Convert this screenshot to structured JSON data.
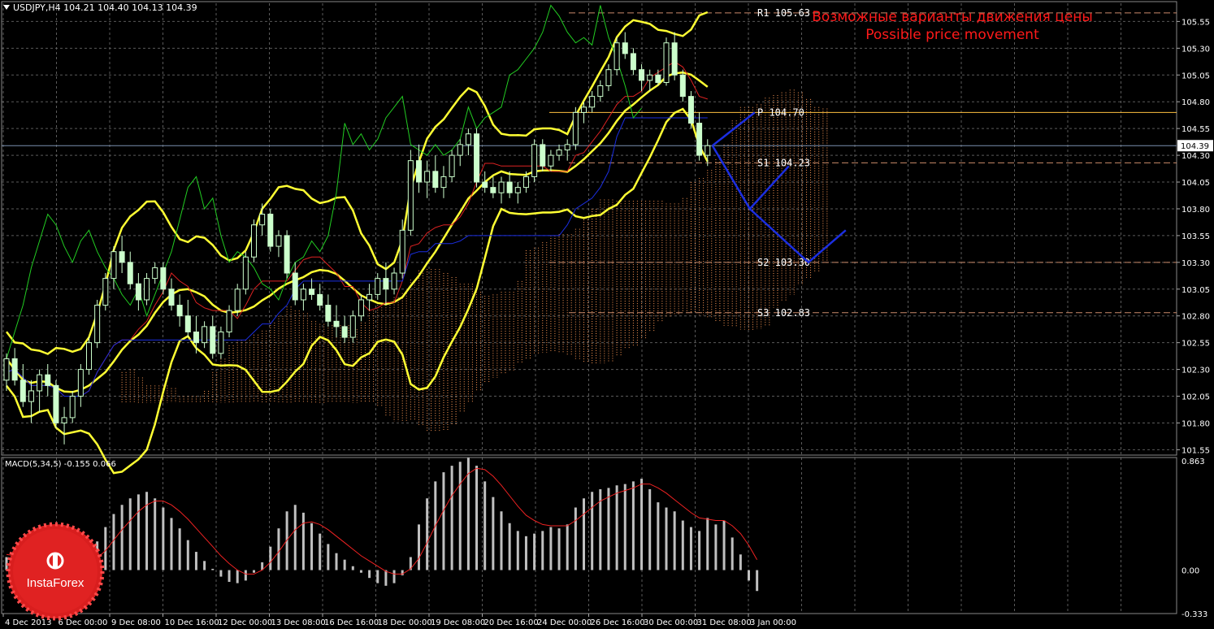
{
  "header": {
    "symbol_line": "USDJPY,H4  104.21 104.40 104.13 104.39"
  },
  "macd_header": "MACD(5,34,5) -0.155 0.066",
  "annotation": {
    "ru": "Возможные варианты движения цены",
    "en": "Possible price movement"
  },
  "logo_text": "InstaForex",
  "colors": {
    "bg": "#000000",
    "grid": "#5a5a5a",
    "yellow": "#ffff33",
    "green": "#22cc22",
    "red": "#dd2222",
    "blue": "#1b2ee0",
    "cloud": "#ff9955",
    "macd_bar": "#c0c0c0",
    "signal": "#ee2222",
    "level": "#c98a6a",
    "pivot": "#ffc040",
    "annotation": "#ff1a1a"
  },
  "chart_data": [
    {
      "type": "line",
      "title": "USDJPY,H4",
      "price_axis": {
        "ticks": [
          "105.55",
          "105.30",
          "105.05",
          "104.80",
          "104.55",
          "104.30",
          "104.05",
          "103.80",
          "103.55",
          "103.30",
          "103.05",
          "102.80",
          "102.55",
          "102.30",
          "102.05",
          "101.80",
          "101.55"
        ],
        "range": [
          101.5,
          105.72
        ]
      },
      "time_axis": {
        "ticks": [
          "4 Dec 2013",
          "6 Dec 00:00",
          "9 Dec 08:00",
          "10 Dec 16:00",
          "12 Dec 00:00",
          "13 Dec 08:00",
          "16 Dec 16:00",
          "18 Dec 00:00",
          "19 Dec 08:00",
          "20 Dec 16:00",
          "24 Dec 00:00",
          "26 Dec 16:00",
          "30 Dec 00:00",
          "31 Dec 08:00",
          "3 Jan 00:00"
        ]
      },
      "current_price": "104.39",
      "levels": [
        {
          "name": "R1",
          "label": "R1 105.63",
          "value": 105.63
        },
        {
          "name": "P",
          "label": "P 104.70",
          "value": 104.7
        },
        {
          "name": "S1",
          "label": "S1 104.23",
          "value": 104.23
        },
        {
          "name": "S2",
          "label": "S2 103.30",
          "value": 103.3
        },
        {
          "name": "S3",
          "label": "S3 102.83",
          "value": 102.83
        }
      ],
      "candles": [
        [
          102.2,
          102.45,
          102.1,
          102.4
        ],
        [
          102.4,
          102.5,
          102.15,
          102.2
        ],
        [
          102.2,
          102.35,
          101.95,
          102.0
        ],
        [
          102.0,
          102.2,
          101.8,
          102.1
        ],
        [
          102.1,
          102.3,
          101.9,
          102.25
        ],
        [
          102.25,
          102.35,
          102.05,
          102.15
        ],
        [
          102.15,
          102.2,
          101.75,
          101.8
        ],
        [
          101.8,
          101.95,
          101.6,
          101.85
        ],
        [
          101.85,
          102.1,
          101.8,
          102.05
        ],
        [
          102.05,
          102.35,
          101.95,
          102.3
        ],
        [
          102.3,
          102.6,
          102.25,
          102.55
        ],
        [
          102.55,
          102.95,
          102.5,
          102.9
        ],
        [
          102.9,
          103.2,
          102.85,
          103.15
        ],
        [
          103.15,
          103.45,
          103.05,
          103.4
        ],
        [
          103.4,
          103.55,
          103.2,
          103.3
        ],
        [
          103.3,
          103.4,
          103.05,
          103.1
        ],
        [
          103.1,
          103.2,
          102.85,
          102.95
        ],
        [
          102.95,
          103.2,
          102.9,
          103.15
        ],
        [
          103.15,
          103.3,
          103.1,
          103.25
        ],
        [
          103.25,
          103.3,
          103.0,
          103.05
        ],
        [
          103.05,
          103.15,
          102.85,
          102.9
        ],
        [
          102.9,
          103.0,
          102.7,
          102.8
        ],
        [
          102.8,
          102.95,
          102.6,
          102.65
        ],
        [
          102.65,
          102.8,
          102.45,
          102.55
        ],
        [
          102.55,
          102.75,
          102.5,
          102.7
        ],
        [
          102.7,
          102.8,
          102.4,
          102.45
        ],
        [
          102.45,
          102.7,
          102.4,
          102.65
        ],
        [
          102.65,
          102.9,
          102.6,
          102.85
        ],
        [
          102.85,
          103.1,
          102.8,
          103.05
        ],
        [
          103.05,
          103.4,
          103.0,
          103.35
        ],
        [
          103.35,
          103.7,
          103.3,
          103.65
        ],
        [
          103.65,
          103.85,
          103.55,
          103.75
        ],
        [
          103.75,
          103.8,
          103.4,
          103.45
        ],
        [
          103.45,
          103.6,
          103.35,
          103.55
        ],
        [
          103.55,
          103.6,
          103.15,
          103.2
        ],
        [
          103.2,
          103.3,
          102.9,
          102.95
        ],
        [
          102.95,
          103.1,
          102.85,
          103.05
        ],
        [
          103.05,
          103.15,
          102.95,
          103.0
        ],
        [
          103.0,
          103.1,
          102.85,
          102.9
        ],
        [
          102.9,
          103.0,
          102.7,
          102.75
        ],
        [
          102.75,
          102.9,
          102.6,
          102.7
        ],
        [
          102.7,
          102.8,
          102.55,
          102.6
        ],
        [
          102.6,
          102.85,
          102.55,
          102.8
        ],
        [
          102.8,
          103.0,
          102.75,
          102.95
        ],
        [
          102.95,
          103.1,
          102.85,
          103.0
        ],
        [
          103.0,
          103.2,
          102.95,
          103.15
        ],
        [
          103.15,
          103.3,
          102.9,
          103.05
        ],
        [
          103.05,
          103.25,
          103.0,
          103.2
        ],
        [
          103.2,
          103.7,
          103.15,
          103.6
        ],
        [
          103.6,
          104.35,
          103.55,
          104.25
        ],
        [
          104.25,
          104.4,
          103.95,
          104.05
        ],
        [
          104.05,
          104.25,
          103.9,
          104.15
        ],
        [
          104.15,
          104.3,
          103.95,
          104.0
        ],
        [
          104.0,
          104.2,
          103.9,
          104.1
        ],
        [
          104.1,
          104.35,
          104.05,
          104.3
        ],
        [
          104.3,
          104.45,
          104.2,
          104.4
        ],
        [
          104.4,
          104.55,
          104.3,
          104.5
        ],
        [
          104.5,
          104.55,
          104.0,
          104.05
        ],
        [
          104.05,
          104.15,
          103.95,
          104.0
        ],
        [
          104.0,
          104.1,
          103.9,
          103.95
        ],
        [
          103.95,
          104.1,
          103.85,
          104.05
        ],
        [
          104.05,
          104.15,
          103.9,
          103.95
        ],
        [
          103.95,
          104.05,
          103.85,
          104.0
        ],
        [
          104.0,
          104.15,
          103.95,
          104.1
        ],
        [
          104.1,
          104.45,
          104.05,
          104.4
        ],
        [
          104.4,
          104.45,
          104.15,
          104.2
        ],
        [
          104.2,
          104.35,
          104.15,
          104.3
        ],
        [
          104.3,
          104.4,
          104.25,
          104.35
        ],
        [
          104.35,
          104.45,
          104.25,
          104.4
        ],
        [
          104.4,
          104.75,
          104.35,
          104.7
        ],
        [
          104.7,
          104.8,
          104.6,
          104.75
        ],
        [
          104.75,
          104.9,
          104.7,
          104.85
        ],
        [
          104.85,
          105.0,
          104.8,
          104.95
        ],
        [
          104.95,
          105.15,
          104.9,
          105.1
        ],
        [
          105.1,
          105.4,
          105.05,
          105.35
        ],
        [
          105.35,
          105.45,
          105.2,
          105.25
        ],
        [
          105.25,
          105.3,
          105.05,
          105.1
        ],
        [
          105.1,
          105.15,
          104.9,
          105.0
        ],
        [
          105.0,
          105.1,
          104.9,
          105.05
        ],
        [
          105.05,
          105.1,
          104.95,
          104.98
        ],
        [
          104.98,
          105.4,
          104.95,
          105.35
        ],
        [
          105.35,
          105.45,
          105.0,
          105.05
        ],
        [
          105.05,
          105.1,
          104.8,
          104.85
        ],
        [
          104.85,
          104.9,
          104.55,
          104.6
        ],
        [
          104.6,
          104.7,
          104.25,
          104.3
        ],
        [
          104.3,
          104.45,
          104.2,
          104.39
        ]
      ],
      "projection": {
        "path_a": [
          104.39,
          104.7
        ],
        "path_b": [
          104.39,
          103.8,
          104.2
        ],
        "path_c": [
          103.8,
          103.3,
          103.6
        ]
      }
    },
    {
      "type": "bar",
      "title": "MACD(5,34,5)",
      "axis_ticks": [
        "0.863",
        "0.00",
        "-0.333"
      ],
      "range": [
        -0.333,
        0.863
      ],
      "histogram": [
        0.1,
        0.08,
        0.05,
        0.02,
        0.04,
        0.06,
        0.03,
        -0.02,
        0.0,
        0.05,
        0.12,
        0.22,
        0.33,
        0.43,
        0.5,
        0.55,
        0.58,
        0.6,
        0.55,
        0.48,
        0.4,
        0.32,
        0.23,
        0.14,
        0.07,
        0.01,
        -0.05,
        -0.09,
        -0.1,
        -0.08,
        -0.02,
        0.06,
        0.18,
        0.32,
        0.45,
        0.5,
        0.44,
        0.36,
        0.28,
        0.2,
        0.13,
        0.08,
        0.03,
        -0.02,
        -0.06,
        -0.1,
        -0.12,
        -0.1,
        -0.04,
        0.1,
        0.35,
        0.55,
        0.68,
        0.75,
        0.8,
        0.83,
        0.86,
        0.8,
        0.68,
        0.56,
        0.45,
        0.36,
        0.3,
        0.26,
        0.28,
        0.3,
        0.33,
        0.32,
        0.35,
        0.48,
        0.55,
        0.6,
        0.62,
        0.63,
        0.65,
        0.66,
        0.68,
        0.7,
        0.62,
        0.52,
        0.48,
        0.45,
        0.38,
        0.33,
        0.3,
        0.4,
        0.35,
        0.38,
        0.25,
        0.12,
        -0.08,
        -0.16
      ],
      "signal": [
        0.12,
        0.11,
        0.09,
        0.07,
        0.06,
        0.05,
        0.04,
        0.03,
        0.02,
        0.03,
        0.05,
        0.09,
        0.15,
        0.23,
        0.31,
        0.38,
        0.45,
        0.5,
        0.53,
        0.53,
        0.5,
        0.45,
        0.39,
        0.32,
        0.25,
        0.18,
        0.11,
        0.05,
        0.0,
        -0.03,
        -0.03,
        0.0,
        0.06,
        0.14,
        0.23,
        0.31,
        0.36,
        0.37,
        0.35,
        0.31,
        0.26,
        0.21,
        0.16,
        0.11,
        0.07,
        0.03,
        -0.01,
        -0.03,
        -0.03,
        0.01,
        0.09,
        0.21,
        0.34,
        0.46,
        0.57,
        0.66,
        0.74,
        0.78,
        0.77,
        0.72,
        0.65,
        0.57,
        0.49,
        0.42,
        0.38,
        0.35,
        0.34,
        0.34,
        0.34,
        0.38,
        0.43,
        0.48,
        0.53,
        0.56,
        0.59,
        0.61,
        0.63,
        0.66,
        0.66,
        0.63,
        0.59,
        0.54,
        0.49,
        0.44,
        0.4,
        0.39,
        0.38,
        0.38,
        0.34,
        0.28,
        0.19,
        0.08
      ]
    }
  ]
}
